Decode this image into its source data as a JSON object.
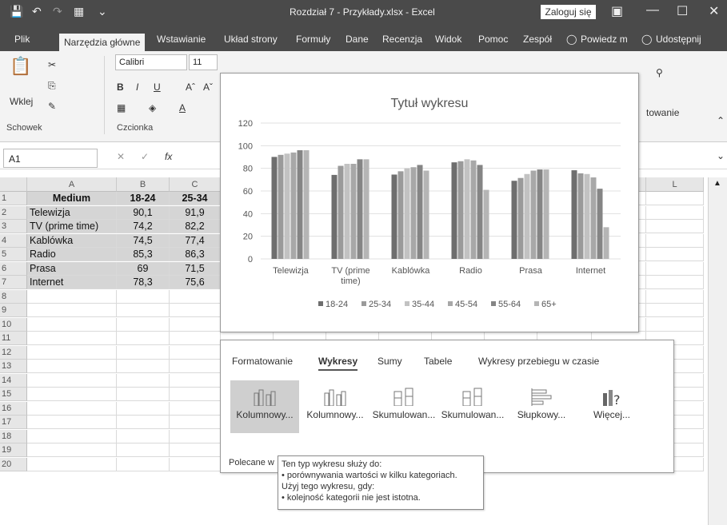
{
  "window": {
    "title": "Rozdział 7 - Przykłady.xlsx  -  Excel",
    "login": "Zaloguj się"
  },
  "tabs": [
    "Plik",
    "Narzędzia główne",
    "Wstawianie",
    "Układ strony",
    "Formuły",
    "Dane",
    "Recenzja",
    "Widok",
    "Pomoc",
    "Zespół",
    "Powiedz m",
    "Udostępnij"
  ],
  "ribbon": {
    "paste_label": "Wklej",
    "clipboard_group": "Schowek",
    "font_name": "Calibri",
    "font_size": "11",
    "font_group": "Czcionka",
    "styles_fragment": "towanie"
  },
  "formula_bar": {
    "namebox": "A1",
    "fx": "fx"
  },
  "sheet": {
    "columns": [
      "A",
      "B",
      "C",
      "L"
    ],
    "rows": [
      "1",
      "2",
      "3",
      "4",
      "5",
      "6",
      "7",
      "8",
      "9",
      "10",
      "11",
      "12",
      "13",
      "14",
      "15",
      "16",
      "17",
      "18",
      "19",
      "20"
    ],
    "header": [
      "Medium",
      "18-24",
      "25-34"
    ],
    "data": [
      [
        "Telewizja",
        "90,1",
        "91,9"
      ],
      [
        "TV (prime time)",
        "74,2",
        "82,2"
      ],
      [
        "Kablówka",
        "74,5",
        "77,4"
      ],
      [
        "Radio",
        "85,3",
        "86,3"
      ],
      [
        "Prasa",
        "69",
        "71,5"
      ],
      [
        "Internet",
        "78,3",
        "75,6"
      ]
    ]
  },
  "chart_data": {
    "type": "bar",
    "title": "Tytuł wykresu",
    "categories": [
      "Telewizja",
      "TV (prime time)",
      "Kablówka",
      "Radio",
      "Prasa",
      "Internet"
    ],
    "ylim": [
      0,
      120
    ],
    "yticks": [
      "0",
      "20",
      "40",
      "60",
      "80",
      "100",
      "120"
    ],
    "grid": true,
    "legend_position": "bottom",
    "series": [
      {
        "name": "18-24",
        "values": [
          90.1,
          74.2,
          74.5,
          85.3,
          69,
          78.3
        ],
        "color": "#6e6e6e"
      },
      {
        "name": "25-34",
        "values": [
          91.9,
          82.2,
          77.4,
          86.3,
          71.5,
          75.6
        ],
        "color": "#9a9a9a"
      },
      {
        "name": "35-44",
        "values": [
          93,
          84,
          80,
          88,
          75,
          75
        ],
        "color": "#c2c2c2"
      },
      {
        "name": "45-54",
        "values": [
          94,
          84,
          81,
          87,
          78,
          72
        ],
        "color": "#a8a8a8"
      },
      {
        "name": "55-64",
        "values": [
          96,
          88,
          83,
          83,
          79,
          62
        ],
        "color": "#858585"
      },
      {
        "name": "65+",
        "values": [
          96,
          88,
          78,
          61,
          79,
          28
        ],
        "color": "#b5b5b5"
      }
    ]
  },
  "quick_analysis": {
    "tabs": [
      "Formatowanie",
      "Wykresy",
      "Sumy",
      "Tabele",
      "Wykresy przebiegu w czasie"
    ],
    "options": [
      "Kolumnowy...",
      "Kolumnowy...",
      "Skumulowan...",
      "Skumulowan...",
      "Słupkowy...",
      "Więcej..."
    ],
    "footer": "Polecane w"
  },
  "tooltip": {
    "line1": "Ten typ wykresu służy do:",
    "line2": "• porównywania wartości w kilku kategoriach.",
    "line3": "Użyj tego wykresu, gdy:",
    "line4": "• kolejność kategorii nie jest istotna."
  }
}
